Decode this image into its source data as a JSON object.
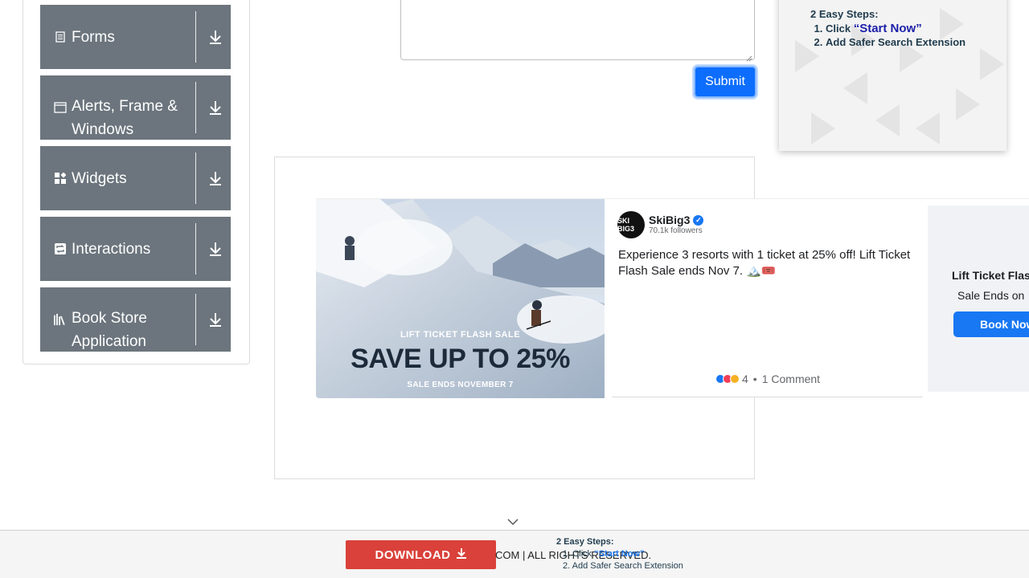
{
  "sidebar": {
    "items": [
      {
        "label": "Forms",
        "icon": "document-icon"
      },
      {
        "label": "Alerts, Frame & Windows",
        "icon": "window-icon"
      },
      {
        "label": "Widgets",
        "icon": "widgets-icon"
      },
      {
        "label": "Interactions",
        "icon": "interactions-icon"
      },
      {
        "label": "Book Store Application",
        "icon": "books-icon"
      }
    ]
  },
  "form": {
    "submit_label": "Submit"
  },
  "promo": {
    "steps_title": "2 Easy Steps:",
    "step1_prefix": "Click ",
    "step1_highlight": "“Start Now”",
    "step2": "Add Safer Search Extension"
  },
  "ad": {
    "image_line1": "LIFT TICKET FLASH SALE",
    "image_line2": "SAVE UP TO 25%",
    "image_line3": "SALE ENDS NOVEMBER 7",
    "logo_text": "SKI BIG3",
    "brand": "SkiBig3",
    "followers": "70.1k followers",
    "body": "Experience 3 resorts with 1 ticket at 25% off! Lift Ticket Flash Sale ends Nov 7. 🏔️🎟️",
    "reactions_count": "4",
    "comments": "1 Comment",
    "side_title": "Lift Ticket Flas",
    "side_subtitle": "Sale Ends on",
    "side_button": "Book Now"
  },
  "footer": {
    "download_label": "DOWNLOAD",
    "copyright": "COM | ALL RIGHTS RESERVED.",
    "steps_title": "2 Easy Steps:",
    "step1_prefix": "1. Click ",
    "step1_highlight": "“Start Now”",
    "step2": "2. Add Safer Search Extension"
  },
  "colors": {
    "menu_bg": "#6c757d",
    "submit": "#0d6efd",
    "download": "#d9413a",
    "facebook_blue": "#1877f2"
  }
}
